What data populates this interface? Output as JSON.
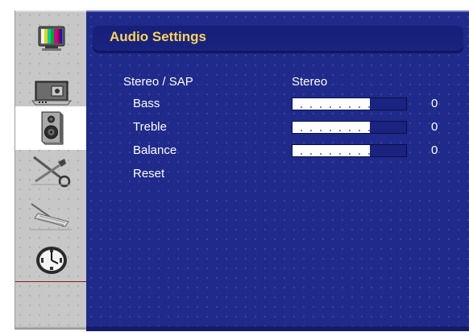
{
  "menu": {
    "title": "Audio Settings",
    "items": [
      {
        "label": "Stereo / SAP",
        "value": "Stereo"
      },
      {
        "label": "Bass",
        "level": 0.68,
        "value": "0"
      },
      {
        "label": "Treble",
        "level": 0.68,
        "value": "0"
      },
      {
        "label": "Balance",
        "level": 0.68,
        "value": "0"
      },
      {
        "label": "Reset"
      }
    ]
  },
  "sidebar": {
    "icons": [
      {
        "name": "picture-settings-icon",
        "selected": false
      },
      {
        "name": "input-source-icon",
        "selected": false
      },
      {
        "name": "audio-speaker-icon",
        "selected": true
      },
      {
        "name": "tools-setup-icon",
        "selected": false
      },
      {
        "name": "tuning-icon",
        "selected": false
      },
      {
        "name": "clock-timer-icon",
        "selected": false
      }
    ]
  },
  "colors": {
    "panel_bg": "#1f2a8a",
    "title": "#ffd35a",
    "text": "#ffffff",
    "sidebar_bg": "#c7c7c7"
  }
}
